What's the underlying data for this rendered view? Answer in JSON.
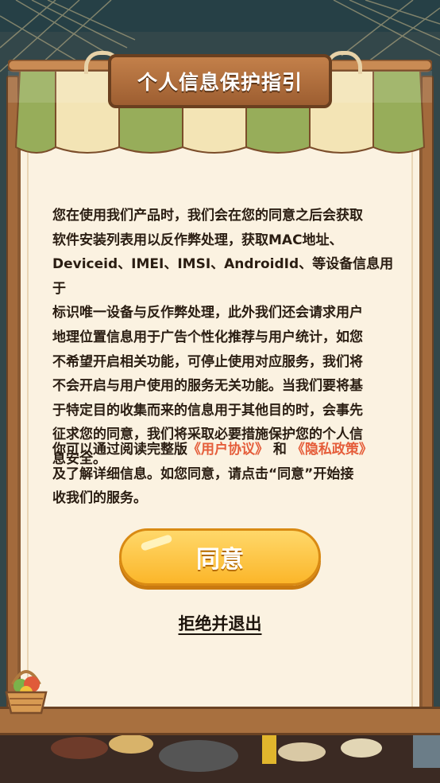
{
  "dialog": {
    "title": "个人信息保护指引",
    "body_lines": [
      "您在使用我们产品时，我们会在您的同意之后会获取",
      "软件安装列表用以反作弊处理，获取MAC地址、",
      "Deviceid、IMEI、IMSI、AndroidId、等设备信息用于",
      "标识唯一设备与反作弊处理，此外我们还会请求用户",
      "地理位置信息用于广告个性化推荐与用户统计，如您",
      "不希望开启相关功能，可停止使用对应服务，我们将",
      "不会开启与用户使用的服务无关功能。当我们要将基",
      "于特定目的收集而来的信息用于其他目的时，会事先",
      "征求您的同意，我们将采取必要措施保护您的个人信",
      "息安全。"
    ],
    "consent_prefix": "你可以通过阅读完整版",
    "user_agreement_link": "《用户协议》",
    "consent_and": "和",
    "privacy_policy_link": "《隐私政策》",
    "consent_line2": "及了解详细信息。如您同意，请点击“同意”开始接",
    "consent_line3": "收我们的服务。",
    "agree_button": "同意",
    "refuse_link": "拒绝并退出"
  },
  "colors": {
    "panel_bg": "#fbf2e1",
    "link": "#e55d3a",
    "button": "#fbb62a",
    "awning_green": "#97ad5a",
    "awning_cream": "#f3e4b5",
    "wood": "#a36a3c"
  }
}
